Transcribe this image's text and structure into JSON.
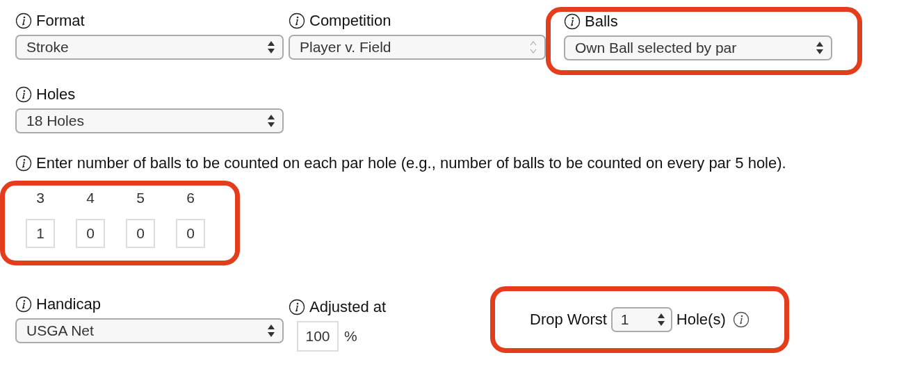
{
  "row_1": [
    {
      "label": "Format",
      "value": "Stroke",
      "disabled": false
    },
    {
      "label": "Competition",
      "value": "Player v. Field",
      "disabled": true
    },
    {
      "label": "Balls",
      "value": "Own Ball selected by par",
      "disabled": false,
      "highlighted": true
    }
  ],
  "row_2": [
    {
      "label": "Holes",
      "value": "18 Holes",
      "disabled": false
    }
  ],
  "instruction": "Enter number of balls to be counted on each par hole (e.g., number of balls to be counted on every par 5 hole).",
  "par_counts": {
    "highlighted": true,
    "items": [
      {
        "par": "3",
        "value": "1"
      },
      {
        "par": "4",
        "value": "0"
      },
      {
        "par": "5",
        "value": "0"
      },
      {
        "par": "6",
        "value": "0"
      }
    ]
  },
  "handicap": {
    "label": "Handicap",
    "value": "USGA Net",
    "disabled": false
  },
  "adjusted": {
    "label": "Adjusted at",
    "value": "100",
    "unit": "%"
  },
  "drop_worst": {
    "highlighted": true,
    "label": "Drop Worst",
    "value": "1",
    "suffix": "Hole(s)"
  }
}
